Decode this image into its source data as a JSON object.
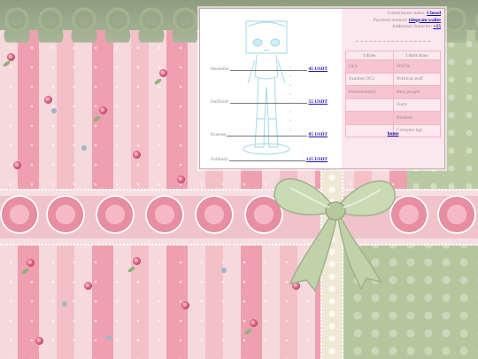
{
  "status": {
    "commission_label": "Commission status:",
    "commission_value": "Closed",
    "payment_label": "Payment method:",
    "payment_value": "telegram wallet",
    "additional_label": "Addtional character:",
    "additional_value": "+15"
  },
  "prices": [
    {
      "name": "Headshot",
      "price": "45 USDT"
    },
    {
      "name": "Halfbody",
      "price": "55 USDT"
    },
    {
      "name": "Kneeup",
      "price": "85 USDT"
    },
    {
      "name": "Fullbody",
      "price": "125 USDT"
    }
  ],
  "table": {
    "headers": [
      "I draw",
      "I dont draw"
    ],
    "rows": [
      [
        "OCs",
        "NSFW"
      ],
      [
        "Fandom OCs",
        "Political stuff"
      ],
      [
        "Kemonomimi",
        "Real people"
      ],
      [
        "",
        "Furry"
      ],
      [
        "",
        "Realism"
      ],
      [
        "",
        "Complex bgs"
      ]
    ]
  },
  "home_link": "home",
  "colors": {
    "link": "#1a0dab",
    "pink_stripe": "#ee9fb0",
    "green_panel": "#b9c9a1",
    "table_pink": "#f7c4d2"
  }
}
